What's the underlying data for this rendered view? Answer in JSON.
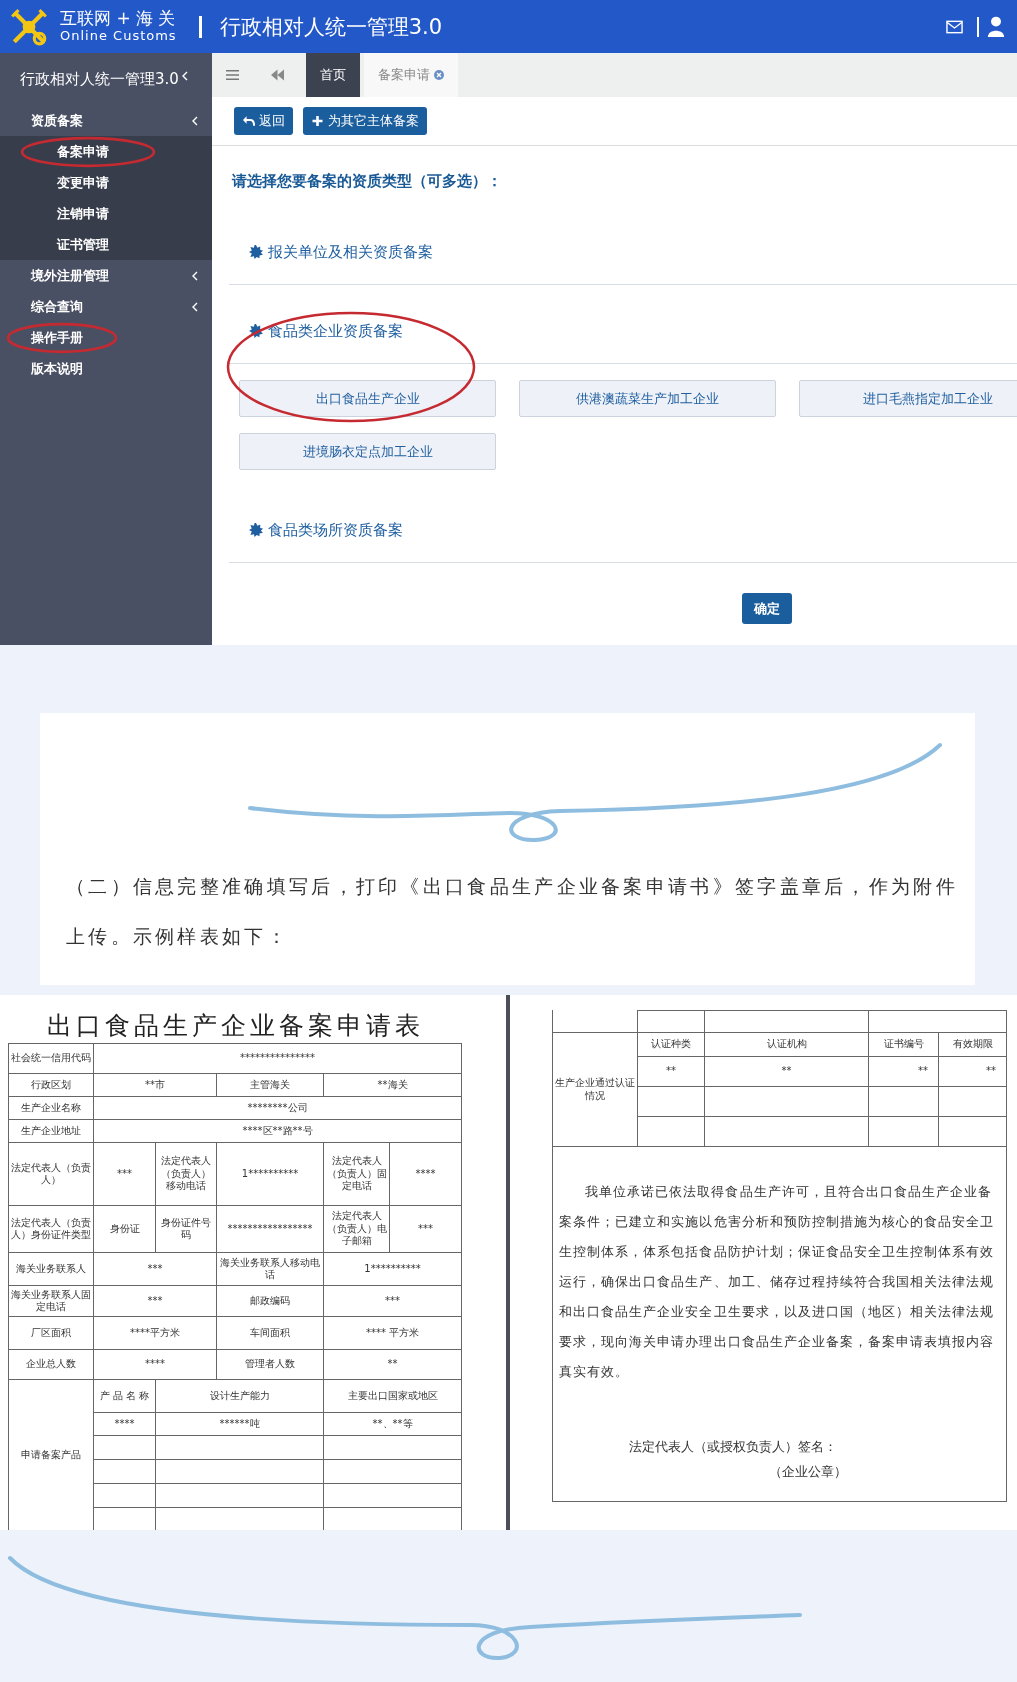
{
  "header": {
    "brand_cn": "互联网 + 海 关",
    "brand_en": "Online Customs",
    "title": "行政相对人统一管理3.0"
  },
  "sidebar": {
    "title": "行政相对人统一管理3.0",
    "items": [
      {
        "label": "资质备案",
        "kind": "group",
        "circled": false,
        "children": [
          {
            "label": "备案申请",
            "circled": true
          },
          {
            "label": "变更申请",
            "circled": false
          },
          {
            "label": "注销申请",
            "circled": false
          },
          {
            "label": "证书管理",
            "circled": false
          }
        ]
      },
      {
        "label": "境外注册管理",
        "kind": "group",
        "circled": false
      },
      {
        "label": "综合查询",
        "kind": "group",
        "circled": false
      },
      {
        "label": "操作手册",
        "kind": "link",
        "circled": true
      },
      {
        "label": "版本说明",
        "kind": "link",
        "circled": false
      }
    ]
  },
  "tabs": [
    {
      "label": "首页",
      "selected": false,
      "closable": false
    },
    {
      "label": "备案申请",
      "selected": true,
      "closable": true
    }
  ],
  "actions": [
    {
      "label": "返回"
    },
    {
      "label": "为其它主体备案"
    }
  ],
  "prompt": "请选择您要备案的资质类型（可多选）：",
  "sections": [
    {
      "title": "报关单位及相关资质备案",
      "circled": false
    },
    {
      "title": "食品类企业资质备案",
      "circled": true,
      "options": [
        "出口食品生产企业",
        "供港澳蔬菜生产加工企业",
        "进口毛燕指定加工企业",
        "进境肠衣定点加工企业"
      ]
    },
    {
      "title": "食品类场所资质备案",
      "circled": false
    }
  ],
  "confirm": "确定",
  "note": "（二）信息完整准确填写后，打印《出口食品生产企业备案申请书》签字盖章后，作为附件上传。示例样表如下：",
  "form": {
    "title": "出口食品生产企业备案申请表",
    "rows": [
      {
        "kind": "wide",
        "cells": [
          "社会统一信用代码",
          "***************"
        ]
      },
      {
        "kind": "split",
        "cells": [
          "行政区划",
          "**市",
          "主管海关",
          "**海关"
        ]
      },
      {
        "kind": "wide",
        "cells": [
          "生产企业名称",
          "********公司"
        ]
      },
      {
        "kind": "wide",
        "cells": [
          "生产企业地址",
          "****区**路**号"
        ]
      },
      {
        "kind": "detail",
        "cells": [
          "法定代表人（负责人）",
          "***",
          "法定代表人（负责人）移动电话",
          "1**********",
          "法定代表人（负责人）固定电话",
          "****"
        ]
      },
      {
        "kind": "detail",
        "cells": [
          "法定代表人（负责人）身份证件类型",
          "身份证",
          "身份证件号码",
          "*****************",
          "法定代表人（负责人）电子邮箱",
          "***"
        ]
      },
      {
        "kind": "split",
        "cells": [
          "海关业务联系人",
          "***",
          "海关业务联系人移动电话",
          "1**********"
        ]
      },
      {
        "kind": "split",
        "cells": [
          "海关业务联系人固定电话",
          "***",
          "邮政编码",
          "***"
        ]
      },
      {
        "kind": "split",
        "cells": [
          "厂区面积",
          "****平方米",
          "车间面积",
          "**** 平方米"
        ]
      },
      {
        "kind": "split",
        "cells": [
          "企业总人数",
          "****",
          "管理者人数",
          "**"
        ]
      }
    ],
    "products": {
      "label": "申请备案产品",
      "columns": [
        "产 品 名 称",
        "设计生产能力",
        "主要出口国家或地区"
      ],
      "rows": [
        [
          "****",
          "******吨",
          "**、**等"
        ]
      ]
    }
  },
  "form_continued": {
    "cert": {
      "label": "生产企业通过认证情况",
      "columns": [
        "认证种类",
        "认证机构",
        "证书编号",
        "有效期限"
      ],
      "values": [
        "**",
        "**",
        "**",
        "**"
      ]
    },
    "pledge": "我单位承诺已依法取得食品生产许可，且符合出口食品生产企业备案条件；已建立和实施以危害分析和预防控制措施为核心的食品安全卫生控制体系，体系包括食品防护计划；保证食品安全卫生控制体系有效运行，确保出口食品生产、加工、储存过程持续符合我国相关法律法规和出口食品生产企业安全卫生要求，以及进口国（地区）相关法律法规要求，现向海关申请办理出口食品生产企业备案，备案申请表填报内容真实有效。",
    "signature": "法定代表人（或授权负责人）签名：",
    "seal": "（企业公章）"
  }
}
